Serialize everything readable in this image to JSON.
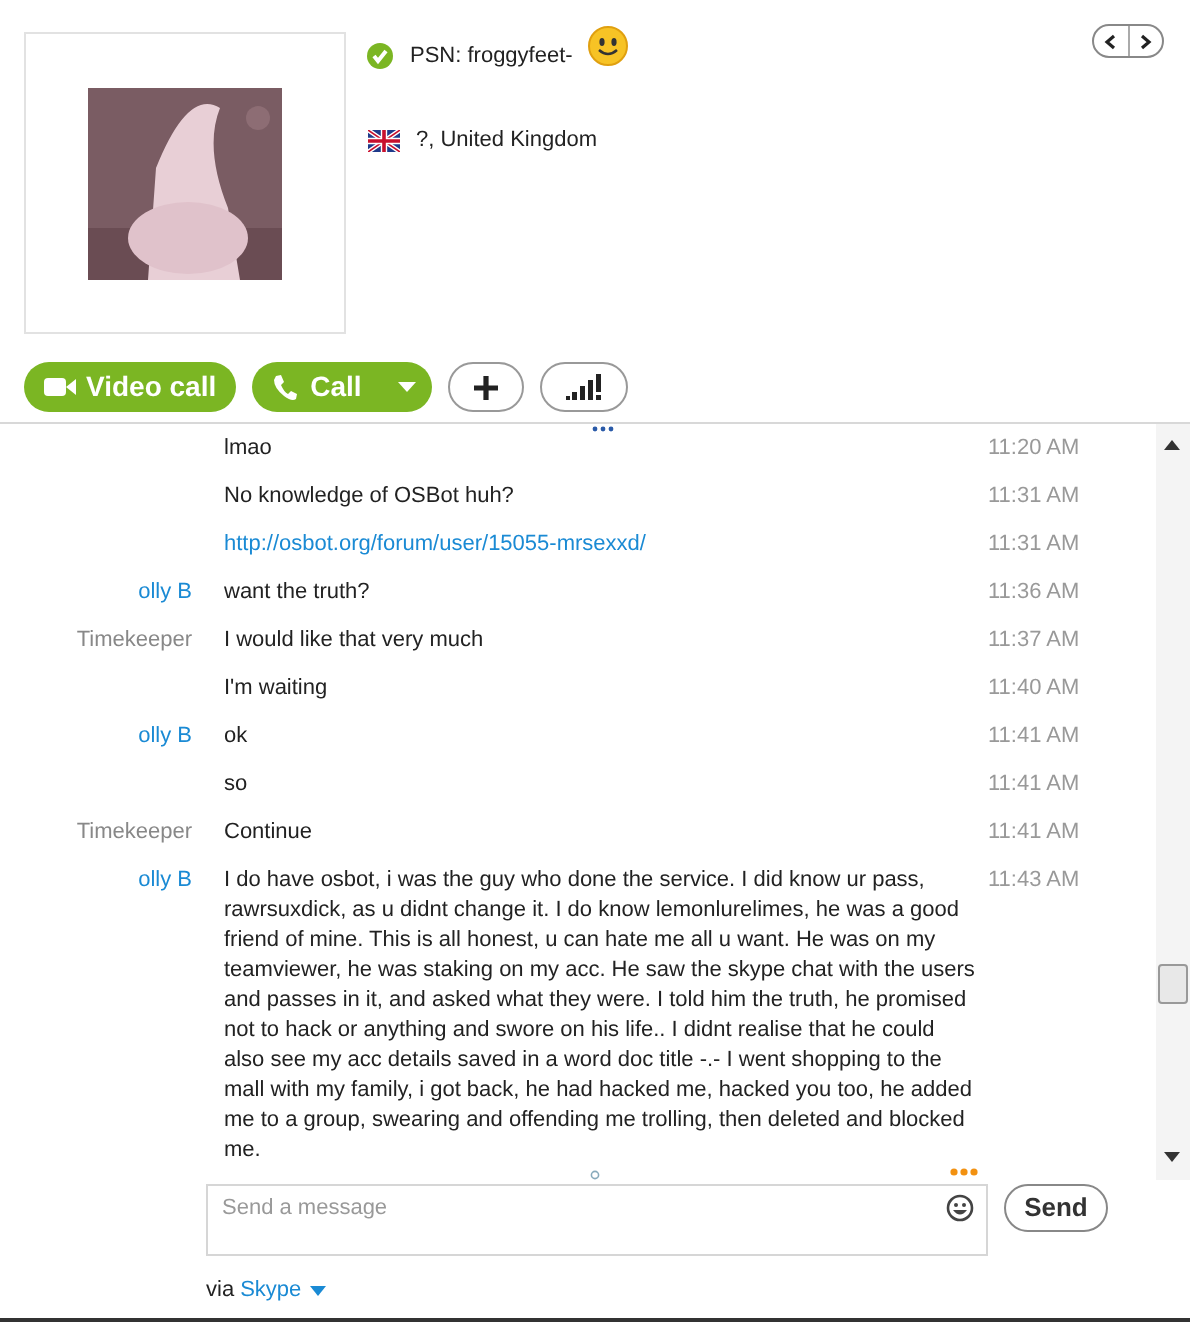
{
  "profile": {
    "mood": "PSN: froggyfeet-",
    "location": "?, United Kingdom",
    "online": true
  },
  "actions": [
    {
      "label": "Video call",
      "kind": "video"
    },
    {
      "label": "Call",
      "kind": "call"
    },
    {
      "kind": "add"
    },
    {
      "kind": "signal"
    }
  ],
  "messages": [
    {
      "text": "lmao",
      "kind": "text",
      "time": "11:20 AM"
    },
    {
      "text": "No knowledge of OSBot huh?",
      "kind": "text",
      "time": "11:31 AM"
    },
    {
      "text": "http://osbot.org/forum/user/15055-mrsexxd/",
      "kind": "link",
      "time": "11:31 AM"
    },
    {
      "sender": "olly B",
      "color": "#1a8ad4",
      "text": "want the truth?",
      "kind": "text",
      "time": "11:36 AM"
    },
    {
      "sender": "Timekeeper",
      "color": "#888888",
      "text": "I would like that very much",
      "kind": "text",
      "time": "11:37 AM"
    },
    {
      "text": "I'm waiting",
      "kind": "text",
      "time": "11:40 AM"
    },
    {
      "sender": "olly B",
      "color": "#1a8ad4",
      "text": "ok",
      "kind": "text",
      "time": "11:41 AM"
    },
    {
      "text": "so",
      "kind": "text",
      "time": "11:41 AM"
    },
    {
      "sender": "Timekeeper",
      "color": "#888888",
      "text": "Continue",
      "kind": "text",
      "time": "11:41 AM"
    },
    {
      "sender": "olly B",
      "color": "#1a8ad4",
      "text": "I do have osbot, i was the guy who done the service. I did know ur pass, rawrsuxdick, as u didnt change it. I do know lemonlurelimes, he was a good friend of mine. This is all honest, u can hate me all u want. He was on my teamviewer, he was staking on my acc. He saw the skype chat with the users and passes in it, and asked what they were. I told him the truth, he promised not to hack or anything and swore on his life.. I didnt realise that he could also see my acc details saved in a word doc title -.- I went shopping to the mall with my family, i got back, he had hacked me, hacked you too, he added me to a group, swearing and offending me trolling, then deleted and blocked me.",
      "kind": "text",
      "time": "11:43 AM"
    }
  ],
  "composer": {
    "placeholder": "Send a message",
    "send": "Send"
  },
  "via": {
    "prefix": "via",
    "service": "Skype"
  }
}
